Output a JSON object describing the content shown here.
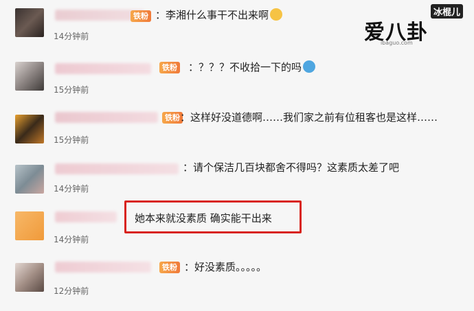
{
  "watermark": {
    "main": "爱八卦",
    "corner": "冰棍儿",
    "url": "ibaguo.com"
  },
  "comments": [
    {
      "badge": "铁粉",
      "text": "：李湘什么事干不出来啊",
      "emoji": "grin-emoji",
      "time": "14分钟前"
    },
    {
      "badge": "铁粉",
      "text": "：？？？不收拾一下的吗",
      "emoji": "doraemon-emoji",
      "time": "15分钟前"
    },
    {
      "badge": "铁粉",
      "text": "：这样好没道德啊……我们家之前有位租客也是这样……",
      "emoji": "",
      "time": "15分钟前"
    },
    {
      "badge": "",
      "text": "：请个保洁几百块都舍不得吗？这素质太差了吧",
      "emoji": "",
      "time": "14分钟前"
    },
    {
      "badge": "",
      "text": "她本来就没素质  确实能干出来",
      "emoji": "",
      "time": "14分钟前"
    },
    {
      "badge": "铁粉",
      "text": "：好没素质。。。。。",
      "emoji": "",
      "time": "12分钟前"
    }
  ],
  "colors": {
    "highlight_border": "#d8231b",
    "badge": "#f07a3a"
  }
}
